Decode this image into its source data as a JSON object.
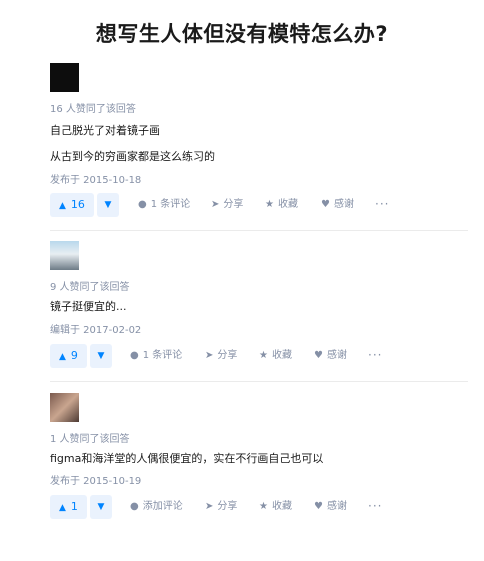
{
  "page": {
    "title": "想写生人体但没有模特怎么办?"
  },
  "answers": [
    {
      "votes_text": "16 人赞同了该回答",
      "body": [
        "自己脱光了对着镜子画",
        "从古到今的穷画家都是这么练习的"
      ],
      "date": "发布于 2015-10-18",
      "upvote_count": "16",
      "comment_label": "1 条评论",
      "avatar_color": "#0d0d0d"
    },
    {
      "votes_text": "9 人赞同了该回答",
      "body": [
        "镜子挺便宜的..."
      ],
      "date": "编辑于 2017-02-02",
      "upvote_count": "9",
      "comment_label": "1 条评论",
      "avatar_color": "#b9d8ec"
    },
    {
      "votes_text": "1 人赞同了该回答",
      "body": [
        "figma和海洋堂的人偶很便宜的，实在不行画自己也可以"
      ],
      "date": "发布于 2015-10-19",
      "upvote_count": "1",
      "comment_label": "添加评论",
      "avatar_color": "#7a5a4e"
    }
  ],
  "actions": {
    "share_label": "分享",
    "collect_label": "收藏",
    "thanks_label": "感谢",
    "more_label": "···",
    "icons": {
      "upvote": "triangle-up-icon",
      "downvote": "triangle-down-icon",
      "comment": "comment-bubble-icon",
      "share": "paper-plane-icon",
      "collect": "star-icon",
      "thanks": "heart-icon",
      "more": "ellipsis-icon"
    }
  },
  "colors": {
    "accent": "#0084ff",
    "vote_bg": "#eaf2fd",
    "meta_text": "#8590a6",
    "divider": "#ebebeb"
  }
}
